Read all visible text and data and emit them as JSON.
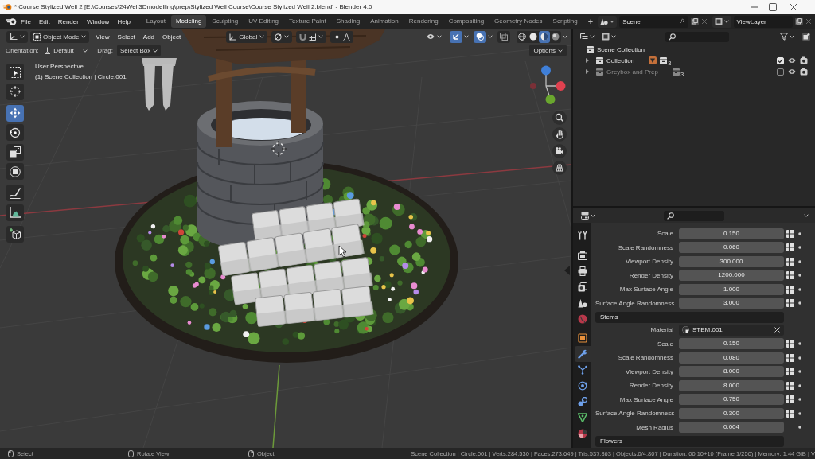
{
  "window": {
    "title": "* Course Stylized Well 2 [E:\\Courses\\24Well3Dmodelling\\prep\\Stylized Well Course\\Course Stylized Well 2.blend] - Blender 4.0"
  },
  "topbar": {
    "menus": [
      "File",
      "Edit",
      "Render",
      "Window",
      "Help"
    ],
    "workspaces": [
      {
        "label": "Layout",
        "selected": false
      },
      {
        "label": "Modeling",
        "selected": true
      },
      {
        "label": "Sculpting",
        "selected": false
      },
      {
        "label": "UV Editing",
        "selected": false
      },
      {
        "label": "Texture Paint",
        "selected": false
      },
      {
        "label": "Shading",
        "selected": false
      },
      {
        "label": "Animation",
        "selected": false
      },
      {
        "label": "Rendering",
        "selected": false
      },
      {
        "label": "Compositing",
        "selected": false
      },
      {
        "label": "Geometry Nodes",
        "selected": false
      },
      {
        "label": "Scripting",
        "selected": false
      }
    ],
    "add_workspace": "+",
    "scene": "Scene",
    "view_layer": "ViewLayer"
  },
  "viewport": {
    "header": {
      "mode": "Object Mode",
      "menus": [
        "View",
        "Select",
        "Add",
        "Object"
      ],
      "orientation": "Global",
      "toggles": [
        {
          "kind": "gizmo",
          "on": true
        },
        {
          "kind": "overlay",
          "on": true
        },
        {
          "kind": "xray",
          "on": false
        }
      ],
      "shading": [
        {
          "kind": "wireframe",
          "selected": false
        },
        {
          "kind": "solid",
          "selected": false
        },
        {
          "kind": "material",
          "selected": true
        },
        {
          "kind": "rendered",
          "selected": false
        }
      ]
    },
    "tool_settings": {
      "orientation_label": "Orientation:",
      "orientation": "Default",
      "drag_label": "Drag:",
      "drag": "Select Box",
      "options": "Options"
    },
    "tool_groups": [
      {
        "tools": [
          {
            "kind": "select_box",
            "selected": false
          },
          {
            "kind": "cursor",
            "selected": false
          }
        ]
      },
      {
        "tools": [
          {
            "kind": "move",
            "selected": true
          },
          {
            "kind": "rotate",
            "selected": false
          },
          {
            "kind": "scale",
            "selected": false
          },
          {
            "kind": "transform",
            "selected": false
          }
        ]
      },
      {
        "tools": [
          {
            "kind": "annotate",
            "selected": false
          },
          {
            "kind": "measure",
            "selected": false
          }
        ]
      },
      {
        "tools": [
          {
            "kind": "add_cube",
            "selected": false
          }
        ]
      }
    ],
    "info": [
      "User Perspective",
      "(1) Scene Collection | Circle.001"
    ]
  },
  "outliner": {
    "items": [
      {
        "label": "Scene Collection",
        "children": [
          {
            "label": "Collection",
            "checked": true,
            "contents": [
              {
                "kind": "object",
                "active": true
              },
              {
                "kind": "collection",
                "count": "3"
              }
            ]
          },
          {
            "label": "Greybox and Prep",
            "checked": false,
            "contents": [
              {
                "kind": "collection",
                "count": "3"
              }
            ]
          }
        ]
      }
    ]
  },
  "properties": {
    "tab_groups": [
      {
        "tabs": [
          {
            "kind": "tool",
            "selected": false
          }
        ]
      },
      {
        "tabs": [
          {
            "kind": "render",
            "selected": false
          },
          {
            "kind": "output",
            "selected": false
          },
          {
            "kind": "view_layer",
            "selected": false
          },
          {
            "kind": "scene",
            "selected": false
          },
          {
            "kind": "world",
            "selected": false
          }
        ]
      },
      {
        "tabs": [
          {
            "kind": "object",
            "selected": false
          },
          {
            "kind": "modifiers",
            "selected": true
          },
          {
            "kind": "particles",
            "selected": false
          },
          {
            "kind": "physics",
            "selected": false
          },
          {
            "kind": "constraints",
            "selected": false
          },
          {
            "kind": "data",
            "selected": false
          },
          {
            "kind": "material",
            "selected": false
          }
        ]
      }
    ],
    "sections": [
      {
        "rows": [
          {
            "kind": "number",
            "label": "Scale",
            "value": "0.150",
            "attribute_toggle": true
          },
          {
            "kind": "number",
            "label": "Scale Randomness",
            "value": "0.060",
            "attribute_toggle": true
          },
          {
            "kind": "number",
            "label": "Viewport Density",
            "value": "300.000",
            "attribute_toggle": true
          },
          {
            "kind": "number",
            "label": "Render Density",
            "value": "1200.000",
            "attribute_toggle": true
          },
          {
            "kind": "number",
            "label": "Max Surface Angle",
            "value": "1.000",
            "attribute_toggle": true
          },
          {
            "kind": "number",
            "label": "Surface Angle Randomness",
            "value": "3.000",
            "attribute_toggle": true
          }
        ]
      },
      {
        "title": "Stems",
        "rows": [
          {
            "kind": "material",
            "label": "Material",
            "value": "STEM.001"
          },
          {
            "kind": "number",
            "label": "Scale",
            "value": "0.150",
            "attribute_toggle": true
          },
          {
            "kind": "number",
            "label": "Scale Randomness",
            "value": "0.080",
            "attribute_toggle": true
          },
          {
            "kind": "number",
            "label": "Viewport Density",
            "value": "8.000",
            "attribute_toggle": true
          },
          {
            "kind": "number",
            "label": "Render Density",
            "value": "8.000",
            "attribute_toggle": true
          },
          {
            "kind": "number",
            "label": "Max Surface Angle",
            "value": "0.750",
            "attribute_toggle": true
          },
          {
            "kind": "number",
            "label": "Surface Angle Randomness",
            "value": "0.300",
            "attribute_toggle": true
          },
          {
            "kind": "number",
            "label": "Mesh Radius",
            "value": "0.004",
            "attribute_toggle": false
          }
        ]
      },
      {
        "title": "Flowers"
      }
    ]
  },
  "status_bar": {
    "hints": [
      {
        "kind": "left_click",
        "label": "Select"
      },
      {
        "kind": "middle_click",
        "label": "Rotate View"
      },
      {
        "kind": "right_click",
        "label": "Object"
      }
    ],
    "stats": "Scene Collection | Circle.001 | Verts:284.530 | Faces:273.649 | Tris:537.863 | Objects:0/4.807 | Duration: 00:10+10 (Frame 1/250) | Memory: 1.44 GiB | V"
  }
}
